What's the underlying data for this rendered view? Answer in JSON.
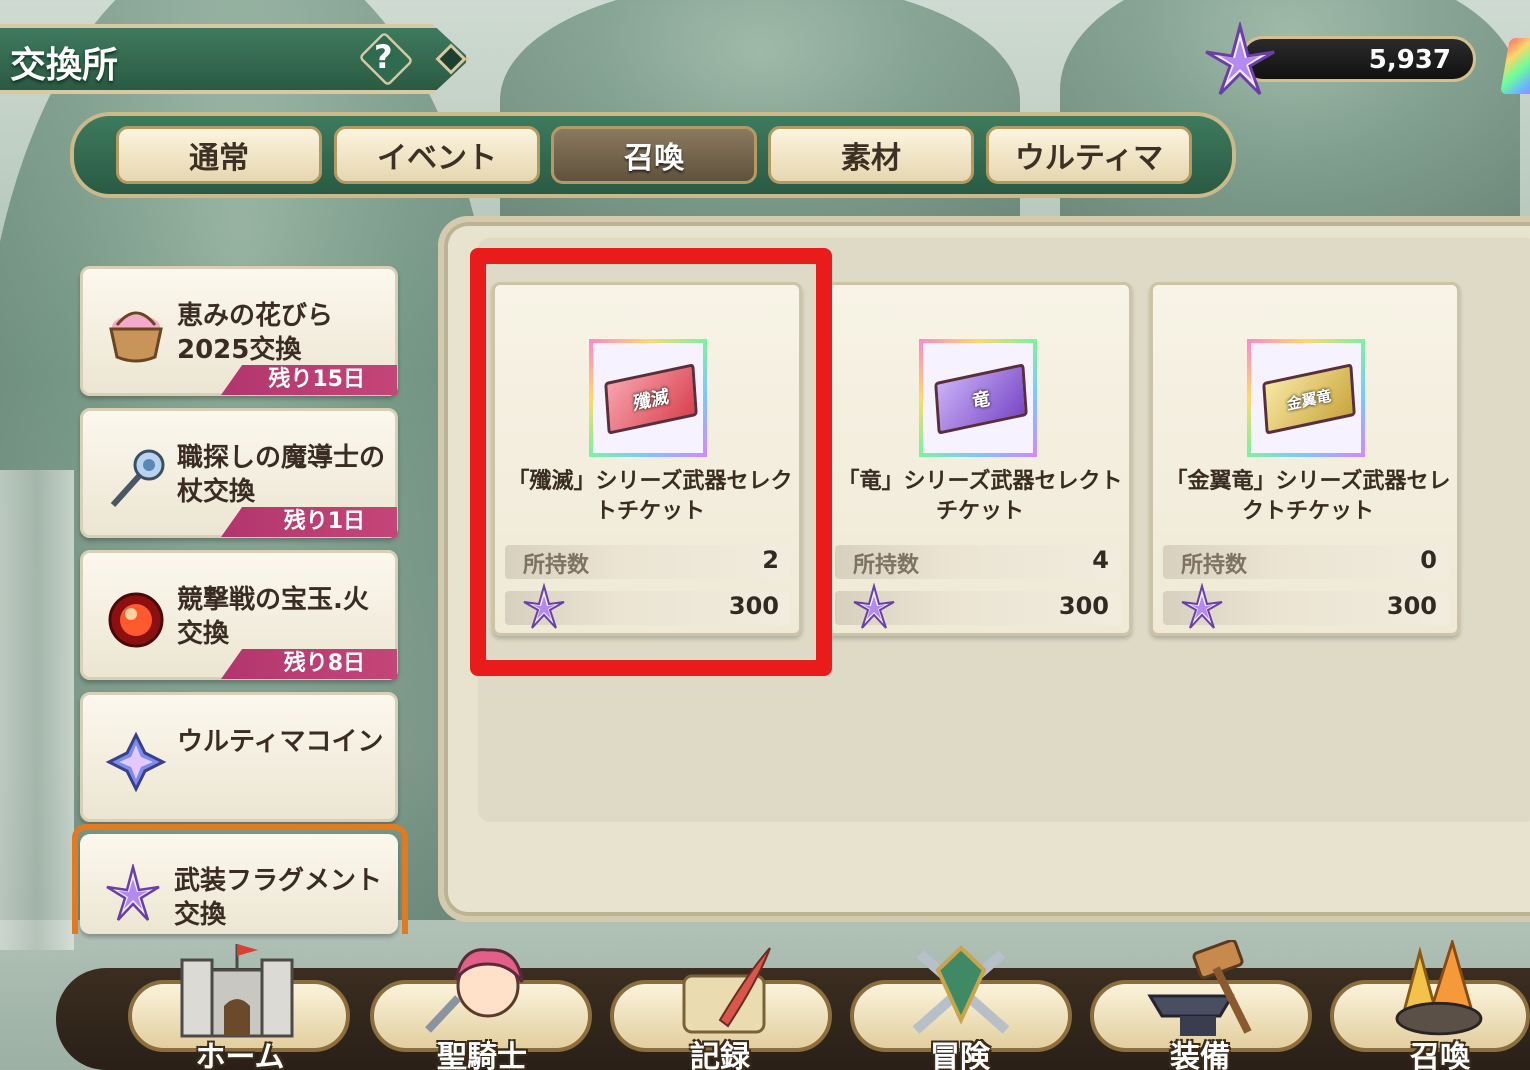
{
  "header": {
    "title": "交換所",
    "help_label": "?"
  },
  "currency": {
    "value": "5,937",
    "icon": "fragment-star-icon"
  },
  "tabs": [
    {
      "label": "通常",
      "active": false
    },
    {
      "label": "イベント",
      "active": false
    },
    {
      "label": "召喚",
      "active": true
    },
    {
      "label": "素材",
      "active": false
    },
    {
      "label": "ウルティマ",
      "active": false
    }
  ],
  "sidebar": [
    {
      "label": "恵みの花びら2025交換",
      "remaining": "残り15日",
      "icon": "flower-basket-icon"
    },
    {
      "label": "職探しの魔導士の杖交換",
      "remaining": "残り1日",
      "icon": "staff-icon"
    },
    {
      "label": "競撃戦の宝玉.火交換",
      "remaining": "残り8日",
      "icon": "fire-orb-icon"
    },
    {
      "label": "ウルティマコイン",
      "remaining": "",
      "icon": "ultima-coin-icon"
    },
    {
      "label": "武装フラグメント交換",
      "remaining": "",
      "icon": "fragment-star-icon",
      "selected": true
    }
  ],
  "cards": [
    {
      "name": "「殲滅」シリーズ武器セレクトチケット",
      "ticket_text": "殲滅",
      "owned_label": "所持数",
      "owned": "2",
      "cost": "300",
      "color": "#d9434f"
    },
    {
      "name": "「竜」シリーズ武器セレクトチケット",
      "ticket_text": "竜",
      "owned_label": "所持数",
      "owned": "4",
      "cost": "300",
      "color": "#7a48c8"
    },
    {
      "name": "「金翼竜」シリーズ武器セレクトチケット",
      "ticket_text": "金翼竜",
      "owned_label": "所持数",
      "owned": "0",
      "cost": "300",
      "color": "#c9a63d"
    }
  ],
  "nav": [
    {
      "label": "ホーム",
      "icon": "castle-icon"
    },
    {
      "label": "聖騎士",
      "icon": "knight-icon"
    },
    {
      "label": "記録",
      "icon": "scroll-quill-icon"
    },
    {
      "label": "冒険",
      "icon": "crossed-swords-icon"
    },
    {
      "label": "装備",
      "icon": "anvil-hammer-icon"
    },
    {
      "label": "召喚",
      "icon": "summon-crystal-icon"
    }
  ],
  "colors": {
    "highlight": "#ea1b1b",
    "accent_green": "#2f6b50",
    "badge": "#b2366e"
  }
}
